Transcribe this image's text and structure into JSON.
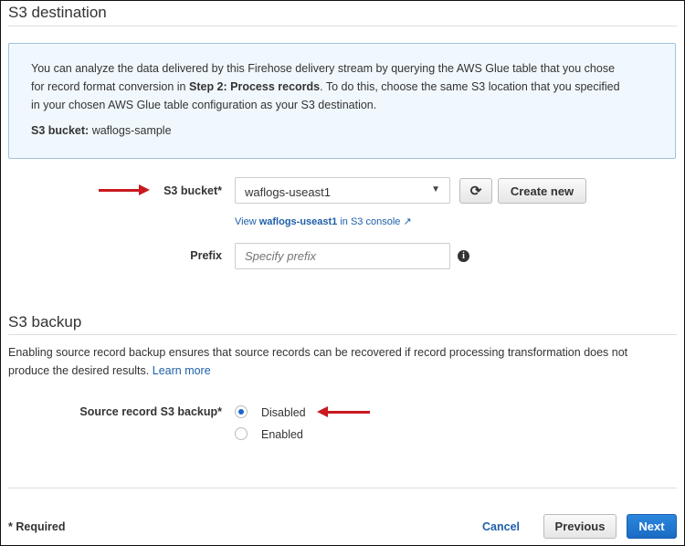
{
  "destination": {
    "title": "S3 destination",
    "info": {
      "line1": "You can analyze the data delivered by this Firehose delivery stream by querying the AWS Glue table that you chose",
      "line2_pre": "for record format conversion in ",
      "line2_bold": "Step 2: Process records",
      "line2_post": ". To do this, choose the same S3 location that you specified",
      "line3": "in your chosen AWS Glue table configuration as your S3 destination.",
      "bucket_label": "S3 bucket:",
      "bucket_value": " waflogs-sample"
    },
    "bucket_label": "S3 bucket*",
    "bucket_value": "waflogs-useast1",
    "refresh_icon": "refresh-icon",
    "create_new": "Create new",
    "view_link": {
      "pre": "View ",
      "bold": "waflogs-useast1",
      "post": " in S3 console"
    },
    "prefix_label": "Prefix",
    "prefix_placeholder": "Specify prefix"
  },
  "backup": {
    "title": "S3 backup",
    "desc1": "Enabling source record backup ensures that source records can be recovered if record processing transformation does not",
    "desc2": "produce the desired results.",
    "learn_more": "Learn more",
    "label": "Source record S3 backup*",
    "options": [
      {
        "label": "Disabled",
        "selected": true
      },
      {
        "label": "Enabled",
        "selected": false
      }
    ]
  },
  "footer": {
    "required": "* Required",
    "cancel": "Cancel",
    "previous": "Previous",
    "next": "Next"
  },
  "colors": {
    "arrow": "#c9191f",
    "primary": "#1b73d0",
    "link": "#1f5fa9"
  }
}
